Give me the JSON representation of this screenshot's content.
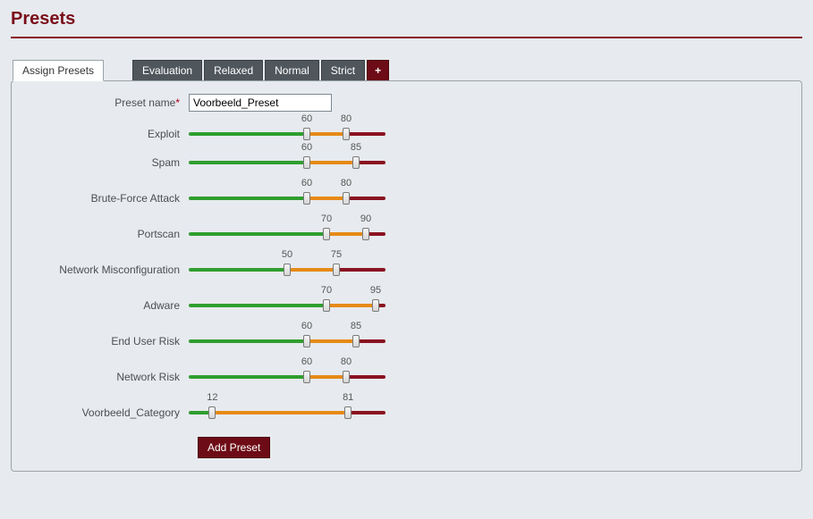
{
  "page": {
    "title": "Presets"
  },
  "tabs": [
    {
      "label": "Assign Presets",
      "active": true
    },
    {
      "label": "Evaluation",
      "active": false
    },
    {
      "label": "Relaxed",
      "active": false
    },
    {
      "label": "Normal",
      "active": false
    },
    {
      "label": "Strict",
      "active": false
    },
    {
      "label": "+",
      "active": false,
      "add": true
    }
  ],
  "form": {
    "preset_name_label": "Preset name",
    "preset_name_value": "Voorbeeld_Preset",
    "add_button_label": "Add Preset"
  },
  "slider_scale": {
    "min": 0,
    "max": 100
  },
  "sliders": [
    {
      "label": "Exploit",
      "low": 60,
      "high": 80
    },
    {
      "label": "Spam",
      "low": 60,
      "high": 85
    },
    {
      "label": "Brute-Force Attack",
      "low": 60,
      "high": 80
    },
    {
      "label": "Portscan",
      "low": 70,
      "high": 90
    },
    {
      "label": "Network Misconfiguration",
      "low": 50,
      "high": 75
    },
    {
      "label": "Adware",
      "low": 70,
      "high": 95
    },
    {
      "label": "End User Risk",
      "low": 60,
      "high": 85
    },
    {
      "label": "Network Risk",
      "low": 60,
      "high": 80
    },
    {
      "label": "Voorbeeld_Category",
      "low": 12,
      "high": 81
    }
  ],
  "colors": {
    "brand": "#6d0b16",
    "green": "#2f9e2f",
    "orange": "#e68a17",
    "red": "#8a1220"
  }
}
